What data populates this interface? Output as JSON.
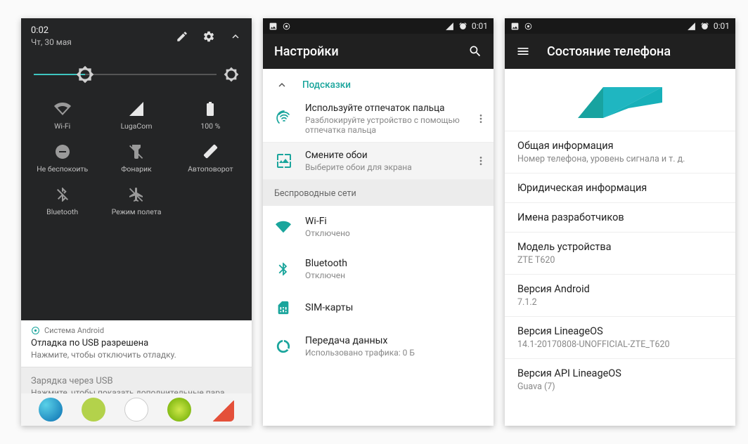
{
  "colors": {
    "teal": "#1aa59c"
  },
  "panel1": {
    "time": "0:02",
    "date": "Чт, 30 мая",
    "tiles": [
      {
        "id": "wifi",
        "label": "Wi-Fi",
        "active": false
      },
      {
        "id": "cell",
        "label": "LugaCom",
        "active": true
      },
      {
        "id": "battery",
        "label": "100 %",
        "active": true
      },
      {
        "id": "dnd",
        "label": "Не беспокоить",
        "active": false
      },
      {
        "id": "flashlight",
        "label": "Фонарик",
        "active": false
      },
      {
        "id": "rotate",
        "label": "Автоповорот",
        "active": true
      },
      {
        "id": "bluetooth",
        "label": "Bluetooth",
        "active": false
      },
      {
        "id": "airplane",
        "label": "Режим полета",
        "active": false
      }
    ],
    "notification1": {
      "app": "Система Android",
      "title": "Отладка по USB разрешена",
      "text": "Нажмите, чтобы отключить отладку."
    },
    "notification2": {
      "title": "Зарядка через USB",
      "text": "Нажмите, чтобы показать дополнительные пара…"
    },
    "brightness_percent": 28
  },
  "panel2": {
    "status_time": "0:01",
    "title": "Настройки",
    "hints_label": "Подсказки",
    "hints": [
      {
        "title": "Используйте отпечаток пальца",
        "subtitle": "Разблокируйте устройство с помощью отпечатка пальца"
      },
      {
        "title": "Смените обои",
        "subtitle": "Выберите обои для экрана"
      }
    ],
    "wireless_section": "Беспроводные сети",
    "rows": [
      {
        "id": "wifi",
        "title": "Wi-Fi",
        "subtitle": "Отключено"
      },
      {
        "id": "bluetooth",
        "title": "Bluetooth",
        "subtitle": "Отключен"
      },
      {
        "id": "sim",
        "title": "SIM-карты",
        "subtitle": ""
      },
      {
        "id": "data",
        "title": "Передача данных",
        "subtitle": "Использовано трафика: 0 Б"
      }
    ]
  },
  "panel3": {
    "status_time": "0:01",
    "title": "Состояние телефона",
    "rows": [
      {
        "title": "Общая информация",
        "subtitle": "Номер телефона, уровень сигнала и т. д."
      },
      {
        "title": "Юридическая информация",
        "subtitle": ""
      },
      {
        "title": "Имена разработчиков",
        "subtitle": ""
      },
      {
        "title": "Модель устройства",
        "subtitle": "ZTE T620"
      },
      {
        "title": "Версия Android",
        "subtitle": "7.1.2"
      },
      {
        "title": "Версия LineageOS",
        "subtitle": "14.1-20170808-UNOFFICIAL-ZTE_T620"
      },
      {
        "title": "Версия API LineageOS",
        "subtitle": "Guava (7)"
      }
    ]
  }
}
